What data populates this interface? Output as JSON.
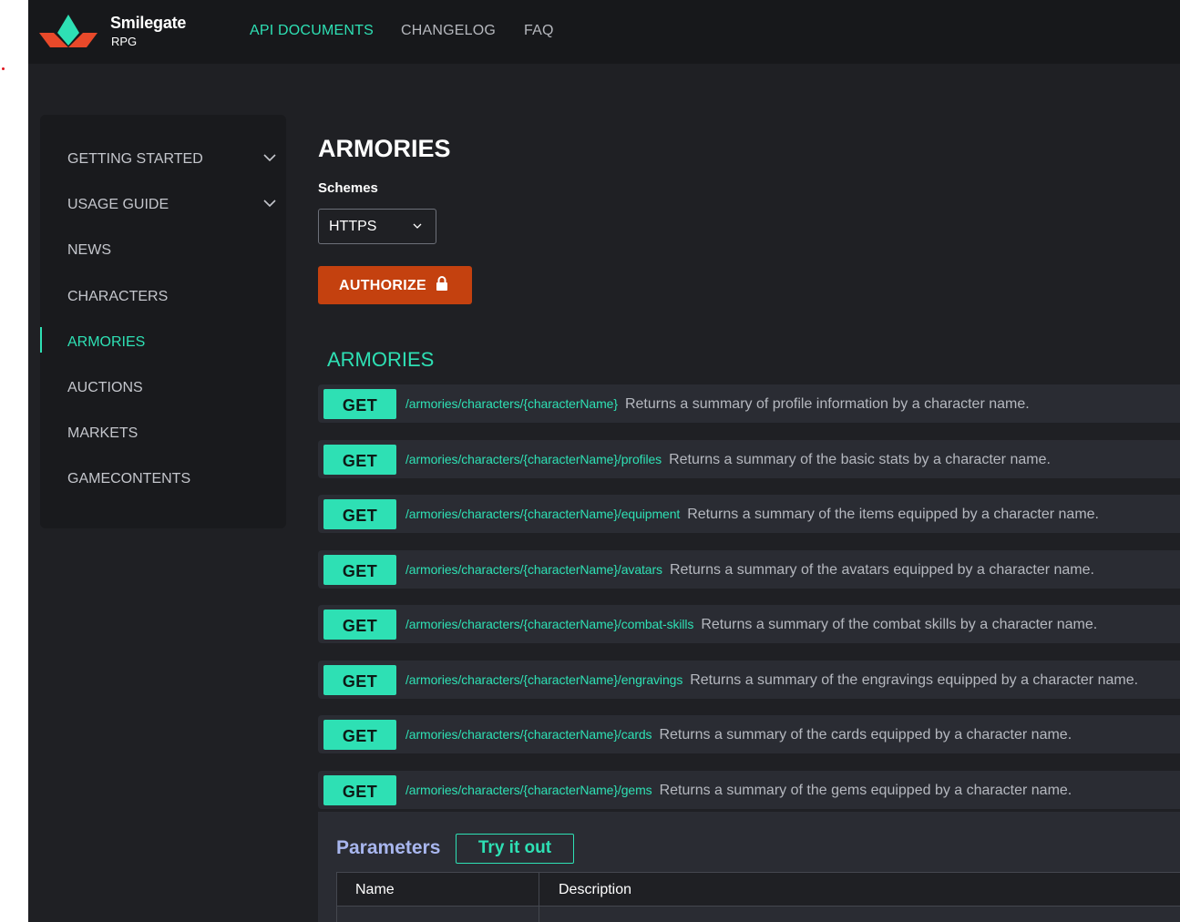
{
  "header": {
    "brand_name": "Smilegate",
    "brand_sub": "RPG",
    "nav": [
      {
        "label": "API DOCUMENTS",
        "active": true
      },
      {
        "label": "CHANGELOG",
        "active": false
      },
      {
        "label": "FAQ",
        "active": false
      }
    ]
  },
  "sidebar": {
    "items": [
      {
        "label": "GETTING STARTED",
        "expandable": true
      },
      {
        "label": "USAGE GUIDE",
        "expandable": true
      },
      {
        "label": "NEWS"
      },
      {
        "label": "CHARACTERS"
      },
      {
        "label": "ARMORIES",
        "active": true
      },
      {
        "label": "AUCTIONS"
      },
      {
        "label": "MARKETS"
      },
      {
        "label": "GAMECONTENTS"
      }
    ]
  },
  "main": {
    "title": "ARMORIES",
    "schemes_label": "Schemes",
    "scheme_value": "HTTPS",
    "authorize_label": "AUTHORIZE",
    "section_title": "ARMORIES",
    "operations": [
      {
        "method": "GET",
        "path": "/armories/characters/{characterName}",
        "summary": "Returns a summary of profile information by a character name."
      },
      {
        "method": "GET",
        "path": "/armories/characters/{characterName}/profiles",
        "summary": "Returns a summary of the basic stats by a character name."
      },
      {
        "method": "GET",
        "path": "/armories/characters/{characterName}/equipment",
        "summary": "Returns a summary of the items equipped by a character name."
      },
      {
        "method": "GET",
        "path": "/armories/characters/{characterName}/avatars",
        "summary": "Returns a summary of the avatars equipped by a character name."
      },
      {
        "method": "GET",
        "path": "/armories/characters/{characterName}/combat-skills",
        "summary": "Returns a summary of the combat skills by a character name."
      },
      {
        "method": "GET",
        "path": "/armories/characters/{characterName}/engravings",
        "summary": "Returns a summary of the engravings equipped by a character name."
      },
      {
        "method": "GET",
        "path": "/armories/characters/{characterName}/cards",
        "summary": "Returns a summary of the cards equipped by a character name."
      },
      {
        "method": "GET",
        "path": "/armories/characters/{characterName}/gems",
        "summary": "Returns a summary of the gems equipped by a character name."
      }
    ],
    "parameters_title": "Parameters",
    "try_label": "Try it out",
    "table_headers": {
      "name": "Name",
      "description": "Description"
    }
  },
  "icons": {
    "logo": "smilegate-logo",
    "lock": "lock-icon",
    "chevron": "chevron-down-icon"
  },
  "colors": {
    "accent": "#2ee0b4",
    "authorize": "#c4410f",
    "background": "#1f2024",
    "topbar": "#17181b",
    "params_title": "#a8b6ee"
  }
}
